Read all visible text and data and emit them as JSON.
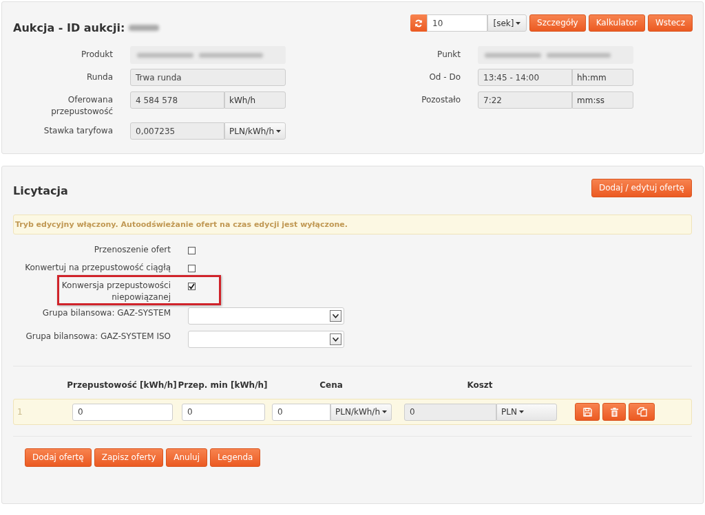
{
  "auction": {
    "title": "Aukcja - ID aukcji:",
    "id_redacted": true,
    "refresh": {
      "value": "10",
      "unit": "[sek]"
    },
    "buttons": [
      "Szczegóły",
      "Kalkulator",
      "Wstecz"
    ],
    "fields_left": [
      {
        "label": "Produkt",
        "kind": "redacted"
      },
      {
        "label": "Runda",
        "kind": "text",
        "value": "Trwa runda"
      },
      {
        "label": "Oferowana przepustowość",
        "kind": "unit",
        "value": "4 584 578",
        "unit": "kWh/h"
      },
      {
        "label": "Stawka taryfowa",
        "kind": "dropdown",
        "value": "0,007235",
        "unit": "PLN/kWh/h"
      }
    ],
    "fields_right": [
      {
        "label": "Punkt",
        "kind": "redacted"
      },
      {
        "label": "Od - Do",
        "kind": "unit",
        "value": "13:45 - 14:00",
        "unit": "hh:mm"
      },
      {
        "label": "Pozostało",
        "kind": "unit",
        "value": "7:22",
        "unit": "mm:ss"
      }
    ]
  },
  "bidding": {
    "title": "Licytacja",
    "edit_button": "Dodaj / edytuj ofertę",
    "alert": "Tryb edycyjny włączony. Autoodświeżanie ofert na czas edycji jest wyłączone.",
    "options": [
      {
        "label": "Przenoszenie ofert",
        "checked": false,
        "highlighted": false
      },
      {
        "label": "Konwertuj na przepustowość ciągłą",
        "checked": false,
        "highlighted": false
      },
      {
        "label": "Konwersja przepustowości niepowiązanej",
        "checked": true,
        "highlighted": true
      }
    ],
    "selects": [
      {
        "label": "Grupa bilansowa: GAZ-SYSTEM"
      },
      {
        "label": "Grupa bilansowa: GAZ-SYSTEM ISO"
      }
    ],
    "table": {
      "columns": [
        "Przepustowość [kWh/h]",
        "Przep. min [kWh/h]",
        "Cena",
        "Koszt"
      ],
      "rows": [
        {
          "index": "1",
          "capacity": "0",
          "min_capacity": "0",
          "price": "0",
          "price_unit": "PLN/kWh/h",
          "cost": "0",
          "cost_currency": "PLN"
        }
      ]
    },
    "buttons": [
      "Dodaj ofertę",
      "Zapisz oferty",
      "Anuluj",
      "Legenda"
    ]
  }
}
